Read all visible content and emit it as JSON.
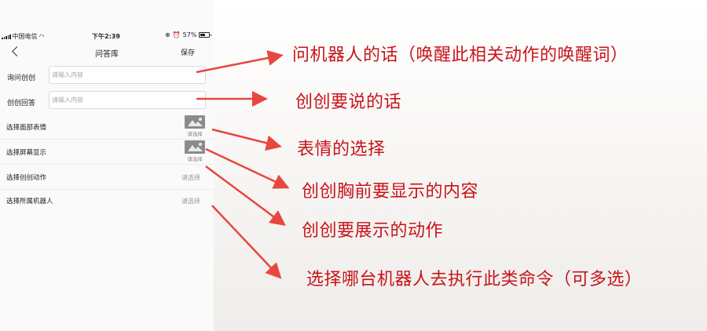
{
  "status_bar": {
    "carrier": "中国电信",
    "wifi_icon": "wifi-icon",
    "time": "下午2:39",
    "icons": [
      "lock-rotation-icon",
      "alarm-icon"
    ],
    "battery": "57%",
    "battery_level": 0.57
  },
  "nav": {
    "back_icon": "chevron-left-icon",
    "title": "问答库",
    "save": "保存"
  },
  "form": {
    "question": {
      "label": "询问创创",
      "placeholder": "请输入内容"
    },
    "answer": {
      "label": "创创回答",
      "placeholder": "请输入内容"
    },
    "face": {
      "label": "选择面部表情",
      "picker": "请选择",
      "icon": "image-icon"
    },
    "screen": {
      "label": "选择屏幕显示",
      "picker": "请选择",
      "icon": "image-icon"
    },
    "action": {
      "label": "选择创创动作",
      "picker": "请选择"
    },
    "robot": {
      "label": "选择所属机器人",
      "picker": "请选择"
    }
  },
  "annotations": {
    "question": "问机器人的话（唤醒此相关动作的唤醒词）",
    "answer": "创创要说的话",
    "face": "表情的选择",
    "screen": "创创胸前要显示的内容",
    "action": "创创要展示的动作",
    "robot": "选择哪台机器人去执行此类命令（可多选）"
  },
  "colors": {
    "annotation": "#c8141a",
    "arrow": "#e8473f"
  }
}
